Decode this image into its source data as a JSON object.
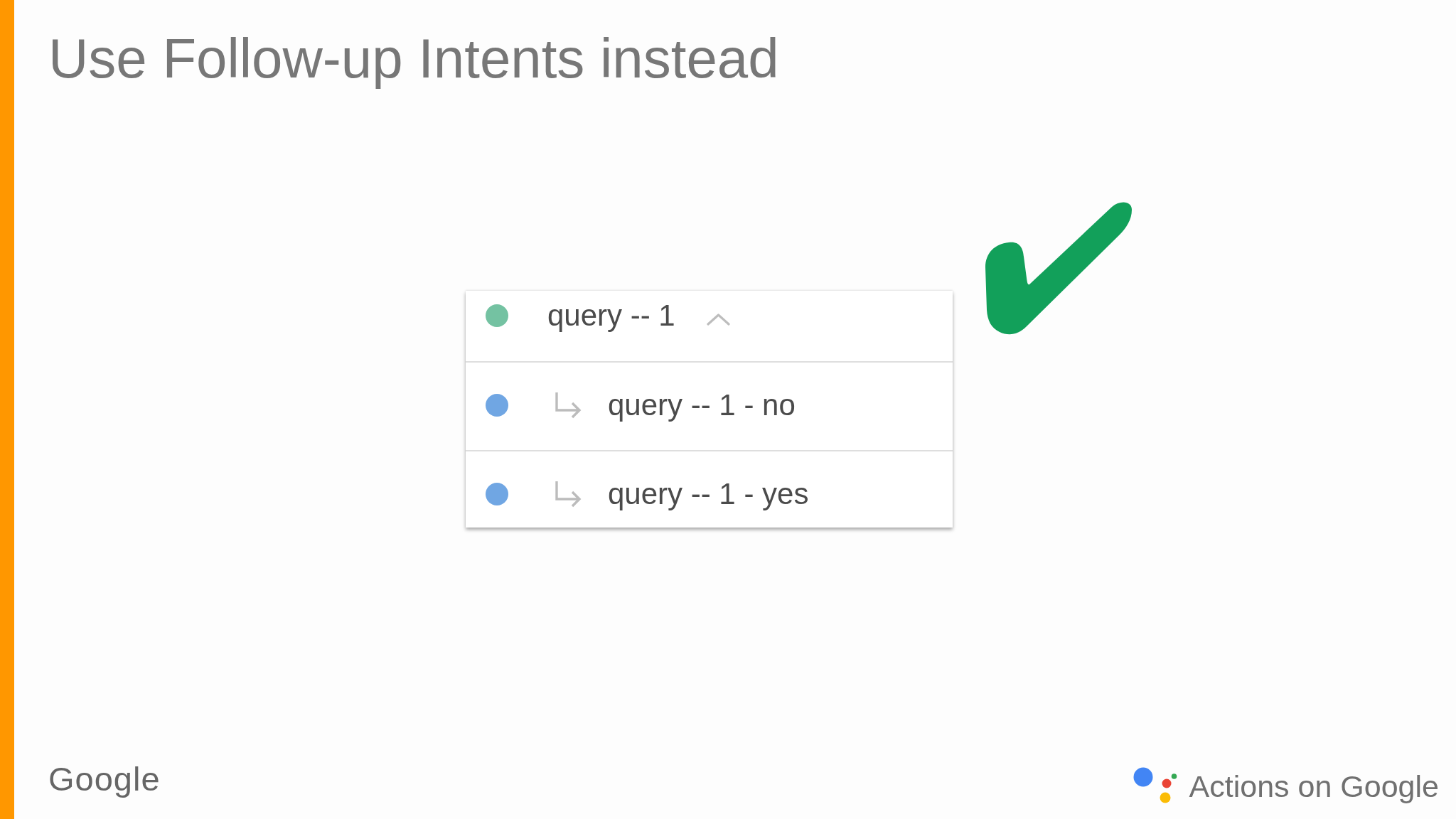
{
  "title": "Use Follow-up Intents instead",
  "intents": [
    {
      "name": "query -- 1",
      "color": "#74c2a2",
      "expanded": true,
      "children": [
        {
          "name": "query -- 1 - no",
          "color": "#70a6e3"
        },
        {
          "name": "query -- 1 - yes",
          "color": "#70a6e3"
        }
      ]
    }
  ],
  "footer": {
    "left_logo": "Google",
    "right_logo": "Actions on Google"
  }
}
